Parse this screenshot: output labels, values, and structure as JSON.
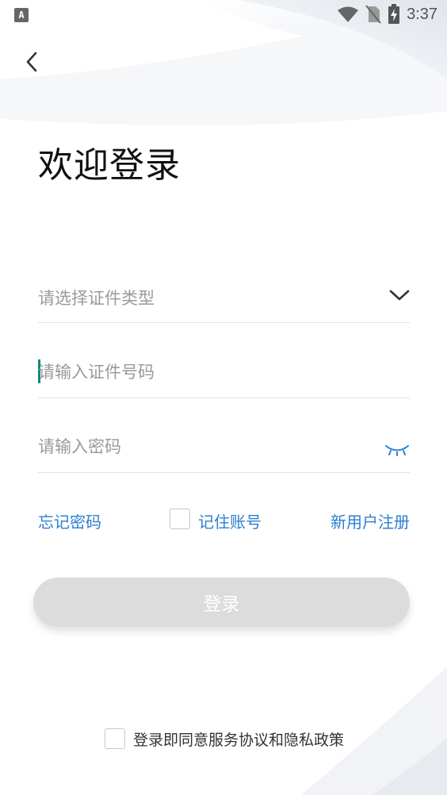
{
  "status_bar": {
    "time": "3:37",
    "left_icon": "A",
    "icons": [
      "wifi-icon",
      "no-sim-icon",
      "battery-charging-icon"
    ]
  },
  "header": {
    "back_icon": "chevron-left-icon",
    "title": "欢迎登录"
  },
  "form": {
    "id_type": {
      "placeholder": "请选择证件类型",
      "icon": "chevron-down-icon"
    },
    "id_number": {
      "placeholder": "请输入证件号码",
      "value": ""
    },
    "password": {
      "placeholder": "请输入密码",
      "value": "",
      "icon": "eye-closed-icon"
    }
  },
  "links": {
    "forgot_password": "忘记密码",
    "remember_account": "记住账号",
    "register": "新用户注册"
  },
  "login_button": {
    "label": "登录"
  },
  "agreement": {
    "label": "登录即同意服务协议和隐私政策",
    "checked": false
  },
  "colors": {
    "link": "#2b7fd0",
    "caret": "#0d8a7a",
    "button_disabled": "#dcdcdc",
    "eye_icon": "#2b7fd0"
  }
}
